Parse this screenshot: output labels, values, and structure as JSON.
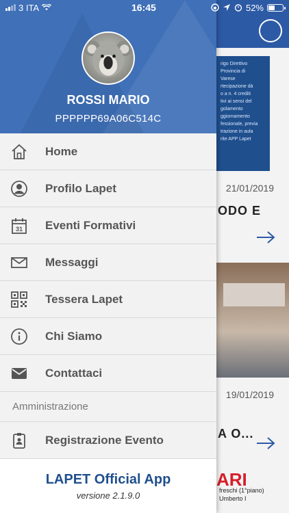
{
  "status_bar": {
    "carrier": "3 ITA",
    "time": "16:45",
    "battery": "52%",
    "battery_level": 0.52
  },
  "profile": {
    "name": "ROSSI MARIO",
    "code": "PPPPPP69A06C514C"
  },
  "menu": {
    "items": [
      {
        "label": "Home",
        "icon": "home-icon"
      },
      {
        "label": "Profilo Lapet",
        "icon": "profile-icon"
      },
      {
        "label": "Eventi Formativi",
        "icon": "calendar-icon"
      },
      {
        "label": "Messaggi",
        "icon": "mail-icon"
      },
      {
        "label": "Tessera Lapet",
        "icon": "qr-code-icon"
      },
      {
        "label": "Chi Siamo",
        "icon": "info-icon"
      },
      {
        "label": "Contattaci",
        "icon": "envelope-filled-icon"
      }
    ],
    "section_title": "Amministrazione",
    "admin_items": [
      {
        "label": "Registrazione Evento",
        "icon": "badge-icon"
      }
    ]
  },
  "footer": {
    "app_name": "LAPET Official App",
    "version": "versione 2.1.9.0"
  },
  "background": {
    "poster_lines": [
      "rigo Direttivo",
      "Provincia di",
      "Varese",
      "",
      "rtecipazione dà",
      "o a n. 4 crediti",
      "tivi ai sensi del",
      "golamento",
      "ggiornamento",
      "fessionale, previa",
      "trazione in aula",
      "rite APP Lapet"
    ],
    "date_1": "21/01/2019",
    "title_1": "ODO E",
    "date_2": "19/01/2019",
    "title_2": "A O...",
    "brand": "ARI",
    "brand_sub": "freschi (1°piano)",
    "brand_sub2": "Umberto I"
  },
  "colors": {
    "header_blue": "#3f70b8",
    "app_bar_blue": "#2d5aa5",
    "title_blue": "#1f4f8d",
    "menu_text": "#555555"
  }
}
